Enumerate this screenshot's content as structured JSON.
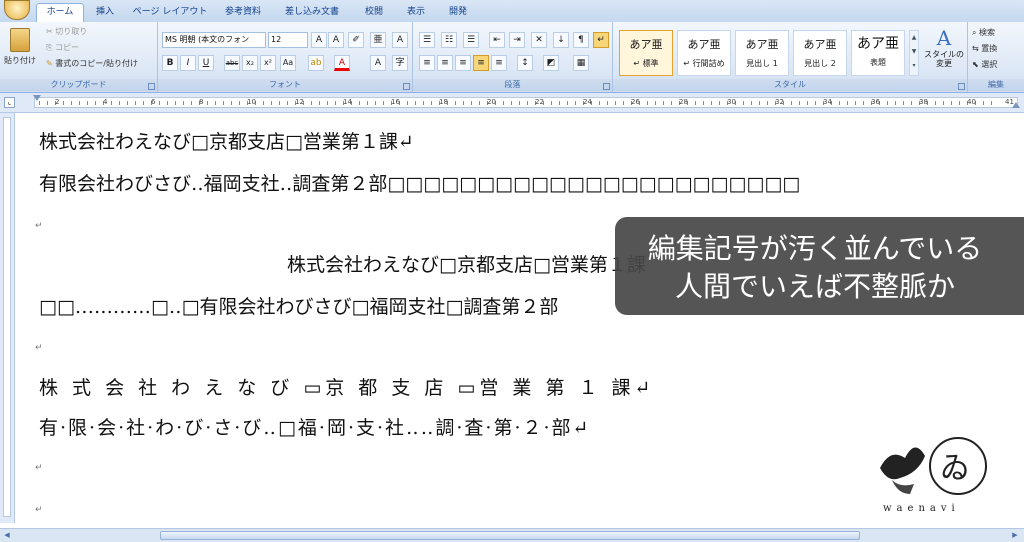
{
  "tabs": [
    "ホーム",
    "挿入",
    "ページ レイアウト",
    "参考資料",
    "差し込み文書",
    "校閲",
    "表示",
    "開発"
  ],
  "clipboard": {
    "paste": "貼り付け",
    "cut": "切り取り",
    "copy": "コピー",
    "format_painter": "書式のコピー/貼り付け",
    "label": "クリップボード"
  },
  "font": {
    "name": "MS 明朝 (本文のフォン",
    "size": "12",
    "label": "フォント"
  },
  "paragraph": {
    "label": "段落"
  },
  "styles": {
    "items": [
      {
        "preview": "あア亜",
        "name": "↵ 標準"
      },
      {
        "preview": "あア亜",
        "name": "↵ 行間詰め"
      },
      {
        "preview": "あア亜",
        "name": "見出し 1"
      },
      {
        "preview": "あア亜",
        "name": "見出し 2"
      },
      {
        "preview": "あア亜",
        "name": "表題"
      }
    ],
    "change": "スタイルの変更",
    "label": "スタイル"
  },
  "editing": {
    "search": "検索",
    "replace": "置換",
    "select": "選択",
    "label": "編集"
  },
  "ruler_numbers": [
    "2",
    "4",
    "6",
    "8",
    "10",
    "12",
    "14",
    "16",
    "18",
    "20",
    "22",
    "24",
    "26",
    "28",
    "30",
    "32",
    "34",
    "36",
    "38",
    "40",
    "41"
  ],
  "document": {
    "lines": [
      "株式会社わえなび□京都支店□営業第１課↵",
      "有限会社わびさび‥福岡支社‥調査第２部□□□□□□□□□□□□□□□□□□□□□□□",
      "↵",
      "株式会社わえなび□京都支店□営業第１課",
      "□□‥‥‥‥‥‥□‥□有限会社わびさび□福岡支社□調査第２部",
      "↵",
      "株 式 会 社 わ え な び ▭京 都 支 店 ▭営 業 第 １ 課↵",
      "有·限·会·社·わ·び·さ·び‥□福·岡·支·社‥‥調·査·第·２·部↵",
      "↵",
      "↵"
    ]
  },
  "caption": {
    "line1": "編集記号が汚く並んでいる",
    "line2": "人間でいえば不整脈か"
  },
  "logo": {
    "text": "waenavi"
  }
}
